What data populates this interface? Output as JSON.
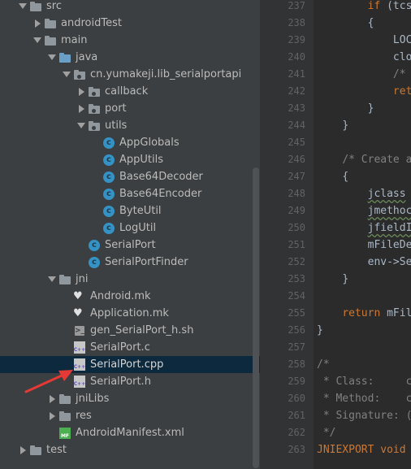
{
  "project_tree": {
    "items": [
      {
        "label": "src",
        "expanded": true,
        "icon": "folder-icon"
      },
      {
        "label": "androidTest",
        "expanded": false,
        "icon": "folder-icon"
      },
      {
        "label": "main",
        "expanded": true,
        "icon": "folder-icon"
      },
      {
        "label": "java",
        "expanded": true,
        "icon": "source-folder-icon"
      },
      {
        "label": "cn.yumakeji.lib_serialportapi",
        "expanded": true,
        "icon": "package-icon"
      },
      {
        "label": "callback",
        "expanded": false,
        "icon": "package-icon"
      },
      {
        "label": "port",
        "expanded": false,
        "icon": "package-icon"
      },
      {
        "label": "utils",
        "expanded": true,
        "icon": "package-icon"
      },
      {
        "label": "AppGlobals",
        "icon": "java-class-icon"
      },
      {
        "label": "AppUtils",
        "icon": "java-class-icon"
      },
      {
        "label": "Base64Decoder",
        "icon": "java-class-icon"
      },
      {
        "label": "Base64Encoder",
        "icon": "java-class-icon"
      },
      {
        "label": "ByteUtil",
        "icon": "java-class-icon"
      },
      {
        "label": "LogUtil",
        "icon": "java-class-icon"
      },
      {
        "label": "SerialPort",
        "icon": "java-class-icon"
      },
      {
        "label": "SerialPortFinder",
        "icon": "java-class-icon"
      },
      {
        "label": "jni",
        "expanded": true,
        "icon": "folder-icon"
      },
      {
        "label": "Android.mk",
        "icon": "makefile-icon"
      },
      {
        "label": "Application.mk",
        "icon": "makefile-icon"
      },
      {
        "label": "gen_SerialPort_h.sh",
        "icon": "shell-script-icon"
      },
      {
        "label": "SerialPort.c",
        "icon": "c-file-icon"
      },
      {
        "label": "SerialPort.cpp",
        "icon": "cpp-file-icon",
        "selected": true
      },
      {
        "label": "SerialPort.h",
        "icon": "header-file-icon"
      },
      {
        "label": "jniLibs",
        "expanded": false,
        "icon": "folder-icon"
      },
      {
        "label": "res",
        "expanded": false,
        "icon": "resource-folder-icon"
      },
      {
        "label": "AndroidManifest.xml",
        "icon": "manifest-icon"
      },
      {
        "label": "test",
        "expanded": false,
        "icon": "folder-icon"
      }
    ]
  },
  "file_icon_text": {
    "cpp": "C++",
    "class": "c",
    "shell": ">_",
    "xml": "MF"
  },
  "editor": {
    "line_numbers": [
      "237",
      "238",
      "239",
      "240",
      "241",
      "242",
      "243",
      "244",
      "245",
      "246",
      "247",
      "248",
      "249",
      "250",
      "251",
      "252",
      "253",
      "254",
      "255",
      "256",
      "257",
      "258",
      "259",
      "260",
      "261",
      "262",
      "263"
    ],
    "lines": [
      {
        "indent": "        ",
        "parts": [
          {
            "t": "if",
            "c": "kw"
          },
          {
            "t": " (tcs",
            "c": ""
          }
        ]
      },
      {
        "indent": "        ",
        "parts": [
          {
            "t": "{",
            "c": ""
          }
        ]
      },
      {
        "indent": "            ",
        "parts": [
          {
            "t": "LOC",
            "c": ""
          }
        ]
      },
      {
        "indent": "            ",
        "parts": [
          {
            "t": "clo",
            "c": ""
          }
        ]
      },
      {
        "indent": "            ",
        "parts": [
          {
            "t": "/*",
            "c": "cm"
          }
        ]
      },
      {
        "indent": "            ",
        "parts": [
          {
            "t": "ret",
            "c": "kw"
          }
        ]
      },
      {
        "indent": "        ",
        "parts": [
          {
            "t": "}",
            "c": ""
          }
        ]
      },
      {
        "indent": "    ",
        "parts": [
          {
            "t": "}",
            "c": ""
          }
        ]
      },
      {
        "indent": "",
        "parts": []
      },
      {
        "indent": "    ",
        "parts": [
          {
            "t": "/* Create a",
            "c": "cm"
          }
        ]
      },
      {
        "indent": "    ",
        "parts": [
          {
            "t": "{",
            "c": ""
          }
        ]
      },
      {
        "indent": "        ",
        "parts": [
          {
            "t": "jclass",
            "c": "ul"
          }
        ]
      },
      {
        "indent": "        ",
        "parts": [
          {
            "t": "jmethoc",
            "c": "ul"
          }
        ]
      },
      {
        "indent": "        ",
        "parts": [
          {
            "t": "jfieldI",
            "c": "ul"
          }
        ]
      },
      {
        "indent": "        ",
        "parts": [
          {
            "t": "mFileDe",
            "c": ""
          }
        ]
      },
      {
        "indent": "        ",
        "parts": [
          {
            "t": "env->Se",
            "c": ""
          }
        ]
      },
      {
        "indent": "    ",
        "parts": [
          {
            "t": "}",
            "c": ""
          }
        ]
      },
      {
        "indent": "",
        "parts": []
      },
      {
        "indent": "    ",
        "parts": [
          {
            "t": "return",
            "c": "kw"
          },
          {
            "t": " mFil",
            "c": ""
          }
        ]
      },
      {
        "indent": "",
        "parts": [
          {
            "t": "}",
            "c": ""
          }
        ]
      },
      {
        "indent": "",
        "parts": []
      },
      {
        "indent": "",
        "parts": [
          {
            "t": "/*",
            "c": "cm"
          }
        ]
      },
      {
        "indent": "",
        "parts": [
          {
            "t": " * Class:     c",
            "c": "cm"
          }
        ]
      },
      {
        "indent": "",
        "parts": [
          {
            "t": " * Method:    c",
            "c": "cm"
          }
        ]
      },
      {
        "indent": "",
        "parts": [
          {
            "t": " * Signature: (",
            "c": "cm"
          }
        ]
      },
      {
        "indent": "",
        "parts": [
          {
            "t": " */",
            "c": "cm"
          }
        ]
      },
      {
        "indent": "",
        "parts": [
          {
            "t": "JNIEXPORT",
            "c": "kw"
          },
          {
            "t": " void",
            "c": "kw"
          }
        ]
      }
    ]
  },
  "annotation": {
    "arrow_color": "#e53935"
  }
}
